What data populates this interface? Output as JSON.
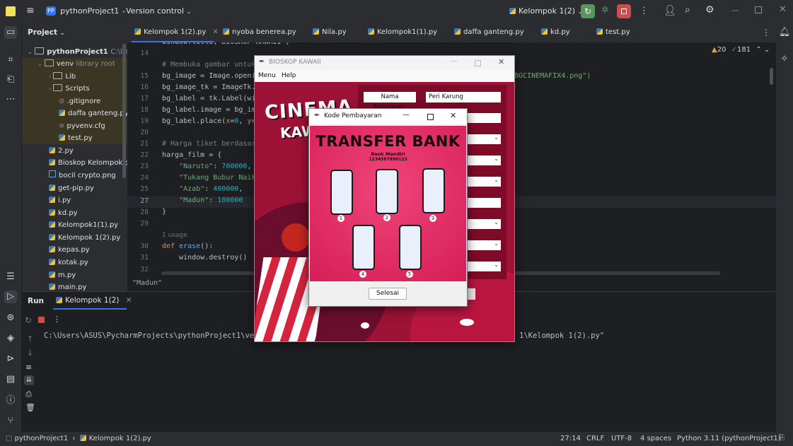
{
  "titlebar": {
    "project_badge": "PP",
    "project_name": "pythonProject1",
    "vcs_menu": "Version control",
    "run_config": "Kelompok 1(2)"
  },
  "tabs": [
    "Kelompok 1(2).py",
    "nyoba benerea.py",
    "Nila.py",
    "Kelompok1(1).py",
    "daffa ganteng.py",
    "kd.py",
    "test.py"
  ],
  "project": {
    "header": "Project",
    "root": "pythonProject1",
    "root_path": "C:\\Use",
    "venv": "venv",
    "venv_note": "library root",
    "items": [
      "Lib",
      "Scripts",
      ".gitignore",
      "daffa ganteng.py",
      "pyvenv.cfg",
      "test.py",
      "2.py",
      "Bioskop Kelompok.py",
      "bocil crypto.png",
      "get-pip.py",
      "i.py",
      "kd.py",
      "Kelompok1(1).py",
      "Kelompok 1(2).py",
      "kepas.py",
      "kotak.py",
      "m.py",
      "main.py"
    ]
  },
  "editor": {
    "line_numbers": [
      "14",
      "15",
      "16",
      "17",
      "18",
      "19",
      "20",
      "21",
      "22",
      "23",
      "24",
      "25",
      "26",
      "27",
      "28",
      "29",
      "",
      "30",
      "31",
      "32"
    ],
    "warnings": "20",
    "checks": "181",
    "usage_hint": "1 usage",
    "breadcrumb": "\"Madun\"",
    "right_overflow": "BGCINEMAFIX4.png\")"
  },
  "run": {
    "tab_run": "Run",
    "tab_config": "Kelompok 1(2)",
    "output_left": "C:\\Users\\ASUS\\PycharmProjects\\pythonProject1\\venv\\S",
    "output_right": "1\\Kelompok 1(2).py\""
  },
  "status": {
    "crumb_project": "pythonProject1",
    "crumb_file": "Kelompok 1(2).py",
    "position": "27:14",
    "line_sep": "CRLF",
    "encoding": "UTF-8",
    "indent": "4 spaces",
    "interpreter": "Python 3.11 (pythonProject1)"
  },
  "kawaii_window": {
    "title": "BIOSKOP KAWAII",
    "menu": [
      "Menu",
      "Help"
    ],
    "logo": "CINEMA",
    "logo2": "KAWA",
    "name_label": "Nama Pelanggan:",
    "name_value": "Peri Karung"
  },
  "payment_window": {
    "title": "Kode Pembayaran",
    "heading": "TRANSFER BANK",
    "bank": "Bank Mandiri",
    "account": "1234567890123",
    "steps": [
      "1",
      "2",
      "3",
      "4",
      "5"
    ],
    "button": "Selesai"
  },
  "colors": {
    "accent_green": "#57965c",
    "stop_red": "#c94f4f",
    "canvas_crimson": "#9d1237",
    "payment_pink": "#e8245f"
  }
}
